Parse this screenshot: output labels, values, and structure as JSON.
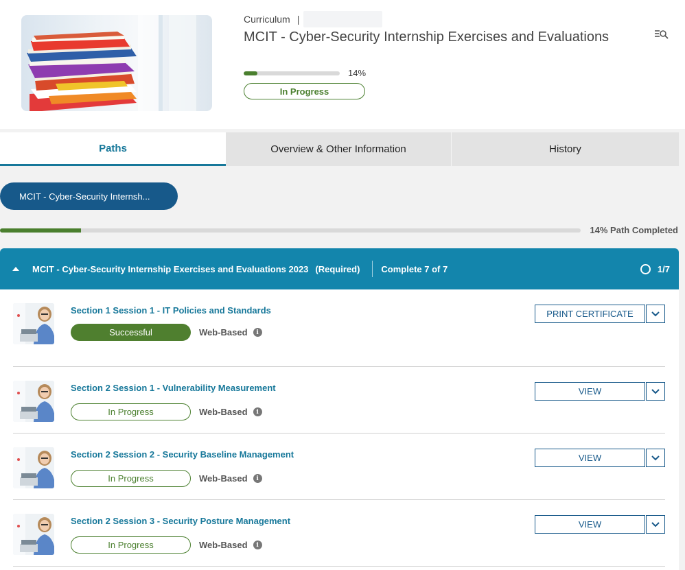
{
  "header": {
    "breadcrumb": "Curriculum",
    "breadcrumb_sep": "|",
    "title": "MCIT - Cyber-Security Internship Exercises and Evaluations",
    "progress_pct": 14,
    "progress_label": "14%",
    "status": "In Progress",
    "menu_icon": "list-search-icon",
    "thumbnail_icon": "book-stack-image"
  },
  "tabs": [
    {
      "label": "Paths",
      "active": true
    },
    {
      "label": "Overview & Other Information",
      "active": false
    },
    {
      "label": "History",
      "active": false
    }
  ],
  "path_pill": "MCIT - Cyber-Security Internsh...",
  "path_progress": {
    "pct": 14,
    "label": "14% Path Completed"
  },
  "section": {
    "name": "MCIT - Cyber-Security Internship Exercises and Evaluations 2023",
    "required": "(Required)",
    "complete": "Complete 7 of 7",
    "count": "1/7"
  },
  "items": [
    {
      "title": "Section 1 Session 1 - IT Policies and Standards",
      "status": "Successful",
      "type": "Web-Based",
      "action": "PRINT CERTIFICATE"
    },
    {
      "title": "Section 2 Session 1 - Vulnerability Measurement",
      "status": "In Progress",
      "type": "Web-Based",
      "action": "VIEW"
    },
    {
      "title": "Section 2 Session 2 - Security Baseline Management",
      "status": "In Progress",
      "type": "Web-Based",
      "action": "VIEW"
    },
    {
      "title": "Section 2 Session 3 - Security Posture Management",
      "status": "In Progress",
      "type": "Web-Based",
      "action": "VIEW"
    }
  ],
  "colors": {
    "primary": "#17598a",
    "teal": "#1385ac",
    "green": "#4a7f2e"
  }
}
